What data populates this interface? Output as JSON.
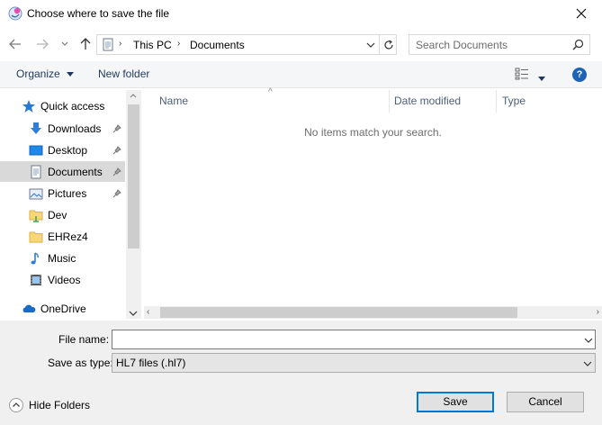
{
  "window": {
    "title": "Choose where to save the file"
  },
  "address": {
    "crumbs": [
      "This PC",
      "Documents"
    ]
  },
  "search": {
    "placeholder": "Search Documents"
  },
  "toolbar": {
    "organize_label": "Organize",
    "new_folder_label": "New folder"
  },
  "nav": {
    "items": [
      {
        "label": "Quick access",
        "icon": "star-icon"
      },
      {
        "label": "Downloads",
        "icon": "download-icon",
        "pinned": true
      },
      {
        "label": "Desktop",
        "icon": "desktop-icon",
        "pinned": true
      },
      {
        "label": "Documents",
        "icon": "documents-icon",
        "pinned": true,
        "selected": true
      },
      {
        "label": "Pictures",
        "icon": "pictures-icon",
        "pinned": true
      },
      {
        "label": "Dev",
        "icon": "folder-icon"
      },
      {
        "label": "EHRez4",
        "icon": "folder-icon"
      },
      {
        "label": "Music",
        "icon": "music-icon"
      },
      {
        "label": "Videos",
        "icon": "videos-icon"
      },
      {
        "label": "OneDrive",
        "icon": "cloud-icon"
      }
    ]
  },
  "content": {
    "columns": [
      "Name",
      "Date modified",
      "Type"
    ],
    "empty_message": "No items match your search."
  },
  "form": {
    "file_name_label": "File name:",
    "file_name_value": "",
    "save_type_label": "Save as type:",
    "save_type_value": "HL7 files (.hl7)"
  },
  "footer": {
    "hide_folders_label": "Hide Folders",
    "save_label": "Save",
    "cancel_label": "Cancel"
  },
  "colors": {
    "accent": "#0078d7",
    "help": "#1c63b7",
    "selected": "#d9d9d9"
  }
}
